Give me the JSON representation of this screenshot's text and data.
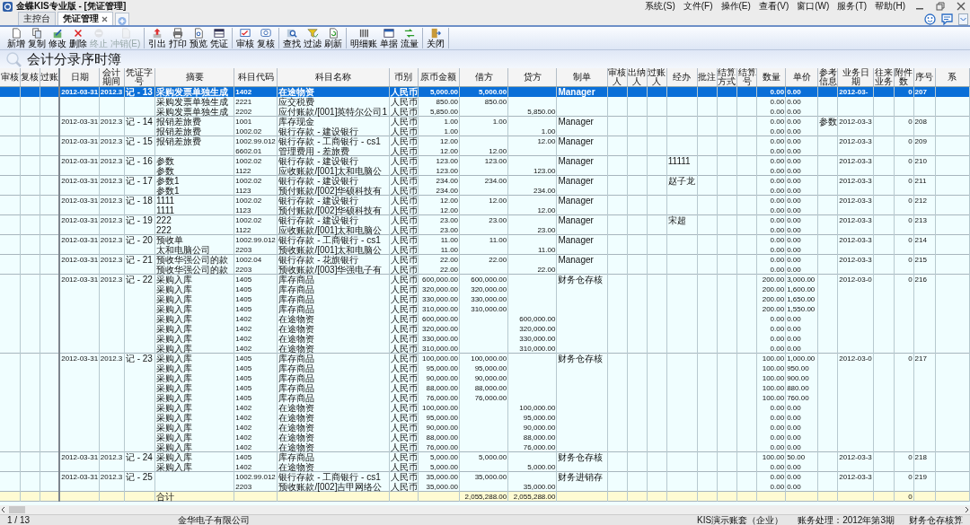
{
  "window": {
    "title": "金蝶KIS专业版 - [凭证管理]"
  },
  "menu": [
    "系统(S)",
    "文件(F)",
    "操作(E)",
    "查看(V)",
    "窗口(W)",
    "服务(T)",
    "帮助(H)"
  ],
  "tabs": [
    {
      "label": "主控台",
      "selected": false,
      "closable": false
    },
    {
      "label": "凭证管理",
      "selected": true,
      "closable": true
    }
  ],
  "toolbar": [
    [
      {
        "label": "新增",
        "disabled": false
      },
      {
        "label": "复制",
        "disabled": false
      },
      {
        "label": "修改",
        "disabled": false
      },
      {
        "label": "删除",
        "disabled": false
      },
      {
        "label": "终止",
        "disabled": true
      },
      {
        "label": "冲销(E)",
        "disabled": true
      }
    ],
    [
      {
        "label": "引出",
        "disabled": false
      },
      {
        "label": "打印",
        "disabled": false
      },
      {
        "label": "预览",
        "disabled": false
      },
      {
        "label": "凭证",
        "disabled": false
      }
    ],
    [
      {
        "label": "审核",
        "disabled": false
      },
      {
        "label": "复核",
        "disabled": false
      }
    ],
    [
      {
        "label": "查找",
        "disabled": false
      },
      {
        "label": "过滤",
        "disabled": false
      },
      {
        "label": "刷新",
        "disabled": false
      }
    ],
    [
      {
        "label": "明细账",
        "disabled": false
      },
      {
        "label": "单据",
        "disabled": false
      },
      {
        "label": "流量",
        "disabled": false
      }
    ],
    [
      {
        "label": "关闭",
        "disabled": false
      }
    ]
  ],
  "page_title": "会计分录序时簿",
  "table": {
    "columns": [
      "审核",
      "复核",
      "过账",
      "日期",
      "会计期间",
      "凭证字号",
      "摘要",
      "科目代码",
      "科目名称",
      "币别",
      "原币金额",
      "借方",
      "贷方",
      "制单",
      "审核人",
      "出纳人",
      "过账人",
      "经办",
      "批注",
      "结算方式",
      "结算号",
      "数量",
      "单价",
      "参考信息",
      "业务日期",
      "往来业务",
      "附件数",
      "序号",
      "系"
    ],
    "vouchers": [
      {
        "date": "2012-03-31",
        "period": "2012.3",
        "number": "记 - 13",
        "maker": "Manager",
        "biz_date": "2012-03-",
        "attachments": "0",
        "seq": "207",
        "lines": [
          {
            "summary": "采购发票单独生成",
            "code": "1402",
            "account": "在途物资",
            "currency": "人民币",
            "amount": "5,000.00",
            "debit": "5,000.00",
            "qty": "0.00",
            "price": "0.00",
            "selected": true
          },
          {
            "summary": "采购发票单独生成",
            "code": "2221",
            "account": "应交税费",
            "currency": "人民币",
            "amount": "850.00",
            "debit": "850.00",
            "qty": "0.00",
            "price": "0.00",
            "selected": false
          },
          {
            "summary": "采购发票单独生成",
            "code": "2202",
            "account": "应付账款/[001]英特尔公司1",
            "currency": "人民币",
            "amount": "5,850.00",
            "credit": "5,850.00",
            "qty": "0.00",
            "price": "0.00",
            "selected": false
          }
        ]
      },
      {
        "date": "2012-03-31",
        "period": "2012.3",
        "number": "记 - 14",
        "maker": "Manager",
        "ref": "参数",
        "biz_date": "2012-03-3",
        "attachments": "0",
        "seq": "208",
        "lines": [
          {
            "summary": "报销差旅费",
            "code": "1001",
            "account": "库存现金",
            "currency": "人民币",
            "amount": "1.00",
            "debit": "1.00",
            "qty": "0.00",
            "price": "0.00",
            "selected": false
          },
          {
            "summary": "报销差旅费",
            "code": "1002.02",
            "account": "银行存款 - 建设银行",
            "currency": "人民币",
            "amount": "1.00",
            "credit": "1.00",
            "qty": "0.00",
            "price": "0.00",
            "selected": false
          }
        ]
      },
      {
        "date": "2012-03-31",
        "period": "2012.3",
        "number": "记 - 15",
        "maker": "Manager",
        "biz_date": "2012-03-3",
        "attachments": "0",
        "seq": "209",
        "lines": [
          {
            "summary": "报销差旅费",
            "code": "1002.99.012",
            "account": "银行存款 - 工商银行 - cs1",
            "currency": "人民币",
            "amount": "12.00",
            "credit": "12.00",
            "qty": "0.00",
            "price": "0.00",
            "selected": false
          },
          {
            "code": "6602.01",
            "account": "管理费用 - 差旅费",
            "currency": "人民币",
            "amount": "12.00",
            "debit": "12.00",
            "qty": "0.00",
            "price": "0.00",
            "selected": false
          }
        ]
      },
      {
        "date": "2012-03-31",
        "period": "2012.3",
        "number": "记 - 16",
        "maker": "Manager",
        "handler": "11111",
        "biz_date": "2012-03-3",
        "attachments": "0",
        "seq": "210",
        "lines": [
          {
            "summary": "参数",
            "code": "1002.02",
            "account": "银行存款 - 建设银行",
            "currency": "人民币",
            "amount": "123.00",
            "debit": "123.00",
            "qty": "0.00",
            "price": "0.00",
            "selected": false
          },
          {
            "summary": "参数",
            "code": "1122",
            "account": "应收账款/[001]太和电脑公",
            "currency": "人民币",
            "amount": "123.00",
            "credit": "123.00",
            "qty": "0.00",
            "price": "0.00",
            "selected": false
          }
        ]
      },
      {
        "date": "2012-03-31",
        "period": "2012.3",
        "number": "记 - 17",
        "maker": "Manager",
        "handler": "赵子龙",
        "biz_date": "2012-03-3",
        "attachments": "0",
        "seq": "211",
        "lines": [
          {
            "summary": "参数1",
            "code": "1002.02",
            "account": "银行存款 - 建设银行",
            "currency": "人民币",
            "amount": "234.00",
            "debit": "234.00",
            "qty": "0.00",
            "price": "0.00",
            "selected": false
          },
          {
            "summary": "参数1",
            "code": "1123",
            "account": "预付账款/[002]华硕科技有",
            "currency": "人民币",
            "amount": "234.00",
            "credit": "234.00",
            "qty": "0.00",
            "price": "0.00",
            "selected": false
          }
        ]
      },
      {
        "date": "2012-03-31",
        "period": "2012.3",
        "number": "记 - 18",
        "maker": "Manager",
        "biz_date": "2012-03-3",
        "attachments": "0",
        "seq": "212",
        "lines": [
          {
            "summary": "1111",
            "code": "1002.02",
            "account": "银行存款 - 建设银行",
            "currency": "人民币",
            "amount": "12.00",
            "debit": "12.00",
            "qty": "0.00",
            "price": "0.00",
            "selected": false
          },
          {
            "summary": "1111",
            "code": "1123",
            "account": "预付账款/[002]华硕科技有",
            "currency": "人民币",
            "amount": "12.00",
            "credit": "12.00",
            "qty": "0.00",
            "price": "0.00",
            "selected": false
          }
        ]
      },
      {
        "date": "2012-03-31",
        "period": "2012.3",
        "number": "记 - 19",
        "maker": "Manager",
        "handler": "宋超",
        "biz_date": "2012-03-3",
        "attachments": "0",
        "seq": "213",
        "lines": [
          {
            "summary": "222",
            "code": "1002.02",
            "account": "银行存款 - 建设银行",
            "currency": "人民币",
            "amount": "23.00",
            "debit": "23.00",
            "qty": "0.00",
            "price": "0.00",
            "selected": false
          },
          {
            "summary": "222",
            "code": "1122",
            "account": "应收账款/[001]太和电脑公",
            "currency": "人民币",
            "amount": "23.00",
            "credit": "23.00",
            "qty": "0.00",
            "price": "0.00",
            "selected": false
          }
        ]
      },
      {
        "date": "2012-03-31",
        "period": "2012.3",
        "number": "记 - 20",
        "maker": "Manager",
        "biz_date": "2012-03-3",
        "attachments": "0",
        "seq": "214",
        "lines": [
          {
            "summary": "预收单",
            "code": "1002.99.012",
            "account": "银行存款 - 工商银行 - cs1",
            "currency": "人民币",
            "amount": "11.00",
            "debit": "11.00",
            "qty": "0.00",
            "price": "0.00",
            "selected": false
          },
          {
            "summary": "太和电脑公司",
            "code": "2203",
            "account": "预收账款/[001]太和电脑公",
            "currency": "人民币",
            "amount": "11.00",
            "credit": "11.00",
            "qty": "0.00",
            "price": "0.00",
            "selected": false
          }
        ]
      },
      {
        "date": "2012-03-31",
        "period": "2012.3",
        "number": "记 - 21",
        "maker": "Manager",
        "biz_date": "2012-03-3",
        "attachments": "0",
        "seq": "215",
        "lines": [
          {
            "summary": "预收华强公司的款",
            "code": "1002.04",
            "account": "银行存款 - 花旗银行",
            "currency": "人民币",
            "amount": "22.00",
            "debit": "22.00",
            "qty": "0.00",
            "price": "0.00",
            "selected": false
          },
          {
            "summary": "预收华强公司的款",
            "code": "2203",
            "account": "预收账款/[003]华强电子有",
            "currency": "人民币",
            "amount": "22.00",
            "credit": "22.00",
            "qty": "0.00",
            "price": "0.00",
            "selected": false
          }
        ]
      },
      {
        "date": "2012-03-31",
        "period": "2012.3",
        "number": "记 - 22",
        "maker": "财务仓存核",
        "biz_date": "2012-03-0",
        "attachments": "0",
        "seq": "216",
        "lines": [
          {
            "summary": "采购入库",
            "code": "1405",
            "account": "库存商品",
            "currency": "人民币",
            "amount": "600,000.00",
            "debit": "600,000.00",
            "qty": "200.00",
            "price": "3,000.00",
            "selected": false
          },
          {
            "summary": "采购入库",
            "code": "1405",
            "account": "库存商品",
            "currency": "人民币",
            "amount": "320,000.00",
            "debit": "320,000.00",
            "qty": "200.00",
            "price": "1,600.00",
            "selected": false
          },
          {
            "summary": "采购入库",
            "code": "1405",
            "account": "库存商品",
            "currency": "人民币",
            "amount": "330,000.00",
            "debit": "330,000.00",
            "qty": "200.00",
            "price": "1,650.00",
            "selected": false
          },
          {
            "summary": "采购入库",
            "code": "1405",
            "account": "库存商品",
            "currency": "人民币",
            "amount": "310,000.00",
            "debit": "310,000.00",
            "qty": "200.00",
            "price": "1,550.00",
            "selected": false
          },
          {
            "summary": "采购入库",
            "code": "1402",
            "account": "在途物资",
            "currency": "人民币",
            "amount": "600,000.00",
            "credit": "600,000.00",
            "qty": "0.00",
            "price": "0.00",
            "selected": false
          },
          {
            "summary": "采购入库",
            "code": "1402",
            "account": "在途物资",
            "currency": "人民币",
            "amount": "320,000.00",
            "credit": "320,000.00",
            "qty": "0.00",
            "price": "0.00",
            "selected": false
          },
          {
            "summary": "采购入库",
            "code": "1402",
            "account": "在途物资",
            "currency": "人民币",
            "amount": "330,000.00",
            "credit": "330,000.00",
            "qty": "0.00",
            "price": "0.00",
            "selected": false
          },
          {
            "summary": "采购入库",
            "code": "1402",
            "account": "在途物资",
            "currency": "人民币",
            "amount": "310,000.00",
            "credit": "310,000.00",
            "qty": "0.00",
            "price": "0.00",
            "selected": false
          }
        ]
      },
      {
        "date": "2012-03-31",
        "period": "2012.3",
        "number": "记 - 23",
        "maker": "财务仓存核",
        "biz_date": "2012-03-0",
        "attachments": "0",
        "seq": "217",
        "lines": [
          {
            "summary": "采购入库",
            "code": "1405",
            "account": "库存商品",
            "currency": "人民币",
            "amount": "100,000.00",
            "debit": "100,000.00",
            "qty": "100.00",
            "price": "1,000.00",
            "selected": false
          },
          {
            "summary": "采购入库",
            "code": "1405",
            "account": "库存商品",
            "currency": "人民币",
            "amount": "95,000.00",
            "debit": "95,000.00",
            "qty": "100.00",
            "price": "950.00",
            "selected": false
          },
          {
            "summary": "采购入库",
            "code": "1405",
            "account": "库存商品",
            "currency": "人民币",
            "amount": "90,000.00",
            "debit": "90,000.00",
            "qty": "100.00",
            "price": "900.00",
            "selected": false
          },
          {
            "summary": "采购入库",
            "code": "1405",
            "account": "库存商品",
            "currency": "人民币",
            "amount": "88,000.00",
            "debit": "88,000.00",
            "qty": "100.00",
            "price": "880.00",
            "selected": false
          },
          {
            "summary": "采购入库",
            "code": "1405",
            "account": "库存商品",
            "currency": "人民币",
            "amount": "76,000.00",
            "debit": "76,000.00",
            "qty": "100.00",
            "price": "760.00",
            "selected": false
          },
          {
            "summary": "采购入库",
            "code": "1402",
            "account": "在途物资",
            "currency": "人民币",
            "amount": "100,000.00",
            "credit": "100,000.00",
            "qty": "0.00",
            "price": "0.00",
            "selected": false
          },
          {
            "summary": "采购入库",
            "code": "1402",
            "account": "在途物资",
            "currency": "人民币",
            "amount": "95,000.00",
            "credit": "95,000.00",
            "qty": "0.00",
            "price": "0.00",
            "selected": false
          },
          {
            "summary": "采购入库",
            "code": "1402",
            "account": "在途物资",
            "currency": "人民币",
            "amount": "90,000.00",
            "credit": "90,000.00",
            "qty": "0.00",
            "price": "0.00",
            "selected": false
          },
          {
            "summary": "采购入库",
            "code": "1402",
            "account": "在途物资",
            "currency": "人民币",
            "amount": "88,000.00",
            "credit": "88,000.00",
            "qty": "0.00",
            "price": "0.00",
            "selected": false
          },
          {
            "summary": "采购入库",
            "code": "1402",
            "account": "在途物资",
            "currency": "人民币",
            "amount": "76,000.00",
            "credit": "76,000.00",
            "qty": "0.00",
            "price": "0.00",
            "selected": false
          }
        ]
      },
      {
        "date": "2012-03-31",
        "period": "2012.3",
        "number": "记 - 24",
        "maker": "财务仓存核",
        "biz_date": "2012-03-3",
        "attachments": "0",
        "seq": "218",
        "lines": [
          {
            "summary": "采购入库",
            "code": "1405",
            "account": "库存商品",
            "currency": "人民币",
            "amount": "5,000.00",
            "debit": "5,000.00",
            "qty": "100.00",
            "price": "50.00",
            "selected": false
          },
          {
            "summary": "采购入库",
            "code": "1402",
            "account": "在途物资",
            "currency": "人民币",
            "amount": "5,000.00",
            "credit": "5,000.00",
            "qty": "0.00",
            "price": "0.00",
            "selected": false
          }
        ]
      },
      {
        "date": "2012-03-31",
        "period": "2012.3",
        "number": "记 - 25",
        "maker": "财务进销存",
        "biz_date": "2012-03-3",
        "attachments": "0",
        "seq": "219",
        "lines": [
          {
            "code": "1002.99.012",
            "account": "银行存款 - 工商银行 - cs1",
            "currency": "人民币",
            "amount": "35,000.00",
            "debit": "35,000.00",
            "qty": "0.00",
            "price": "0.00",
            "selected": false
          },
          {
            "code": "2203",
            "account": "预收账款/[002]吉甲网络公",
            "currency": "人民币",
            "amount": "35,000.00",
            "credit": "35,000.00",
            "qty": "0.00",
            "price": "0.00",
            "selected": false
          }
        ]
      }
    ],
    "total": {
      "label": "合计",
      "debit": "2,055,288.00",
      "credit": "2,055,288.00",
      "attachments": "0"
    }
  },
  "status_bar": {
    "page": "1 / 13",
    "company": "金华电子有限公司",
    "account_set": "KIS演示账套（企业）",
    "period": "账务处理：2012年第3期",
    "module": "财务仓存核算"
  }
}
